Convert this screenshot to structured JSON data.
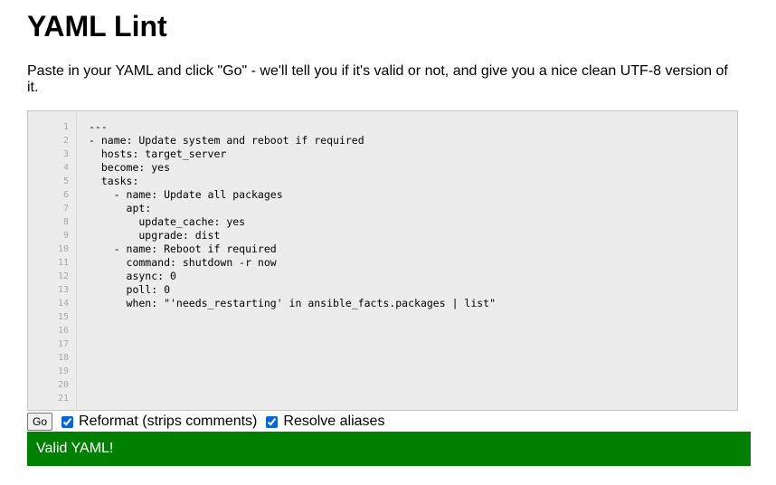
{
  "title": "YAML Lint",
  "intro": "Paste in your YAML and click \"Go\" - we'll tell you if it's valid or not, and give you a nice clean UTF-8 version of it.",
  "editor": {
    "line_numbers": [
      "1",
      "2",
      "3",
      "4",
      "5",
      "6",
      "7",
      "8",
      "9",
      "10",
      "11",
      "12",
      "13",
      "14",
      "15",
      "16",
      "17",
      "18",
      "19",
      "20",
      "21"
    ],
    "lines": [
      "---",
      "- name: Update system and reboot if required",
      "  hosts: target_server",
      "  become: yes",
      "  tasks:",
      "    - name: Update all packages",
      "      apt:",
      "        update_cache: yes",
      "        upgrade: dist",
      "    - name: Reboot if required",
      "      command: shutdown -r now",
      "      async: 0",
      "      poll: 0",
      "      when: \"'needs_restarting' in ansible_facts.packages | list\""
    ]
  },
  "controls": {
    "go_label": "Go",
    "reformat_label": "Reformat (strips comments)",
    "reformat_checked": true,
    "resolve_label": "Resolve aliases",
    "resolve_checked": true
  },
  "result": {
    "message": "Valid YAML!",
    "color": "#008000"
  }
}
